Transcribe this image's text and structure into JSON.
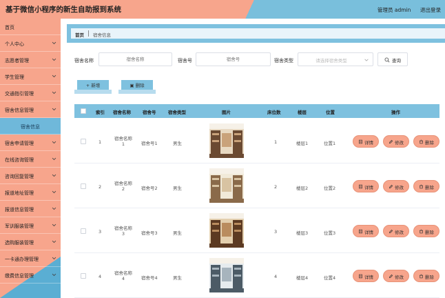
{
  "header": {
    "title": "基于微信小程序的新生自助报到系统",
    "user": "管理员 admin",
    "logout": "退出登录"
  },
  "sidebar": {
    "items": [
      {
        "label": "首页",
        "arrow": false
      },
      {
        "label": "个人中心",
        "arrow": true
      },
      {
        "label": "志愿者管理",
        "arrow": true
      },
      {
        "label": "学生管理",
        "arrow": true
      },
      {
        "label": "交通指引管理",
        "arrow": true
      },
      {
        "label": "宿舍信息管理",
        "arrow": true
      },
      {
        "label": "宿舍信息",
        "arrow": false,
        "sub": true
      },
      {
        "label": "宿舍申请管理",
        "arrow": true
      },
      {
        "label": "在线咨询管理",
        "arrow": true
      },
      {
        "label": "咨询回复管理",
        "arrow": true
      },
      {
        "label": "报道地址管理",
        "arrow": true
      },
      {
        "label": "报道信息管理",
        "arrow": true
      },
      {
        "label": "军训服装管理",
        "arrow": true
      },
      {
        "label": "选购服装管理",
        "arrow": true
      },
      {
        "label": "一卡通办理管理",
        "arrow": true
      },
      {
        "label": "缴费信息管理",
        "arrow": true
      }
    ]
  },
  "breadcrumb": {
    "home": "首页",
    "current": "宿舍信息"
  },
  "search": {
    "name_label": "宿舍名称",
    "name_placeholder": "宿舍名称",
    "number_label": "宿舍号",
    "number_placeholder": "宿舍号",
    "type_label": "宿舍类型",
    "type_placeholder": "请选择宿舍类型",
    "query_label": "查询"
  },
  "actions": {
    "add": "新增",
    "delete": "删除"
  },
  "table": {
    "columns": [
      "索引",
      "宿舍名称",
      "宿舍号",
      "宿舍类型",
      "图片",
      "床位数",
      "楼层",
      "位置",
      "操作"
    ],
    "rows": [
      {
        "index": "1",
        "name_a": "宿舍名称",
        "name_b": "1",
        "number": "宿舍号1",
        "type": "男生",
        "beds": "1",
        "floor": "楼层1",
        "position": "位置1"
      },
      {
        "index": "2",
        "name_a": "宿舍名称",
        "name_b": "2",
        "number": "宿舍号2",
        "type": "男生",
        "beds": "2",
        "floor": "楼层2",
        "position": "位置2"
      },
      {
        "index": "3",
        "name_a": "宿舍名称",
        "name_b": "3",
        "number": "宿舍号3",
        "type": "男生",
        "beds": "3",
        "floor": "楼层3",
        "position": "位置3"
      },
      {
        "index": "4",
        "name_a": "宿舍名称",
        "name_b": "4",
        "number": "宿舍号4",
        "type": "男生",
        "beds": "4",
        "floor": "楼层4",
        "position": "位置4"
      }
    ],
    "row_actions": {
      "detail": "详情",
      "edit": "修改",
      "delete": "删除"
    }
  },
  "colors": {
    "peach": "#f7a58c",
    "blue": "#7ec1df",
    "dark_blue": "#5aaed3"
  }
}
